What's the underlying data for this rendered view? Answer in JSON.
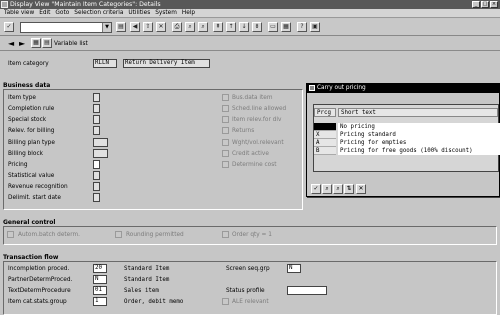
{
  "window": {
    "title": "Display View \"Maintain Item Categories\": Details"
  },
  "menu": [
    "Table view",
    "Edit",
    "Goto",
    "Selection criteria",
    "Utilities",
    "System",
    "Help"
  ],
  "app_toolbar": {
    "variable_list": "Variable list"
  },
  "header": {
    "item_category_label": "Item category",
    "item_category_value": "RLLN",
    "item_category_desc": "Return Delivery Item"
  },
  "business_data": {
    "title": "Business data",
    "left_labels": [
      "Item type",
      "Completion rule",
      "Special stock",
      "Relev. for billing",
      "Billing plan type",
      "Billing block",
      "Pricing",
      "Statistical value",
      "Revenue recognition",
      "Delimit. start date"
    ],
    "right_labels": [
      "Bus.data item",
      "Sched.line allowed",
      "Item relev.for dlv",
      "Returns",
      "Wght/vol.relevant",
      "Credit active",
      "Determine cost"
    ]
  },
  "general_control": {
    "title": "General control",
    "items": [
      "Autom.batch determ.",
      "Rounding permitted",
      "Order qty = 1"
    ]
  },
  "transaction_flow": {
    "title": "Transaction flow",
    "rows": [
      {
        "label": "Incompletion proced.",
        "code": "20",
        "desc": "Standard Item"
      },
      {
        "label": "PartnerDetermProced.",
        "code": "N",
        "desc": "Standard Item"
      },
      {
        "label": "TextDetermProcedure",
        "code": "01",
        "desc": "Sales item"
      },
      {
        "label": "Item cat.stats.group",
        "code": "1",
        "desc": "Order, debit memo"
      }
    ],
    "screen_seq_label": "Screen seq.grp",
    "screen_seq_value": "N",
    "status_profile_label": "Status profile",
    "ale_relevant_label": "ALE relevant"
  },
  "popup": {
    "title": "Carry out pricing",
    "col_code": "Prcg",
    "col_text": "Short text",
    "rows": [
      {
        "code": "",
        "text": "No pricing"
      },
      {
        "code": "X",
        "text": "Pricing standard"
      },
      {
        "code": "A",
        "text": "Pricing for empties"
      },
      {
        "code": "B",
        "text": "Pricing for free goods (100% discount)"
      }
    ]
  }
}
